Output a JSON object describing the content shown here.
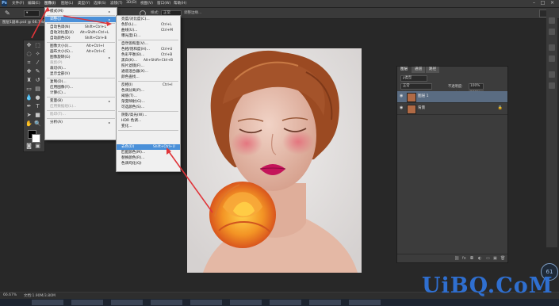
{
  "menubar": {
    "items": [
      "文件(F)",
      "编辑(E)",
      "图像(I)",
      "图层(L)",
      "类型(Y)",
      "选择(S)",
      "滤镜(T)",
      "3D(D)",
      "视图(V)",
      "窗口(W)",
      "帮助(H)"
    ]
  },
  "options_bar": {
    "field_label": "样式:",
    "field_value": "正常",
    "refine_label": "调整边缘..."
  },
  "tab_bar": {
    "doc_title": "图层1副本.psd @ 66.7%(RGB/8)"
  },
  "image_menu": {
    "items": [
      {
        "label": "模式(M)",
        "shortcut": "",
        "submenu": true
      },
      {
        "label": "调整(J)",
        "shortcut": "",
        "submenu": true,
        "highlight": true
      },
      {
        "label": "自动色调(N)",
        "shortcut": "Shift+Ctrl+L"
      },
      {
        "label": "自动对比度(U)",
        "shortcut": "Alt+Shift+Ctrl+L"
      },
      {
        "label": "自动颜色(O)",
        "shortcut": "Shift+Ctrl+B"
      },
      {
        "label": "图像大小(I)...",
        "shortcut": "Alt+Ctrl+I"
      },
      {
        "label": "画布大小(S)...",
        "shortcut": "Alt+Ctrl+C"
      },
      {
        "label": "图像旋转(G)",
        "shortcut": "",
        "submenu": true
      },
      {
        "label": "裁剪(P)",
        "shortcut": "",
        "disabled": true
      },
      {
        "label": "裁切(R)...",
        "shortcut": ""
      },
      {
        "label": "显示全部(V)",
        "shortcut": ""
      },
      {
        "label": "复制(D)...",
        "shortcut": ""
      },
      {
        "label": "应用图像(Y)...",
        "shortcut": ""
      },
      {
        "label": "计算(C)...",
        "shortcut": ""
      },
      {
        "label": "变量(B)",
        "shortcut": "",
        "submenu": true
      },
      {
        "label": "应用数据组(L)...",
        "shortcut": "",
        "disabled": true
      },
      {
        "label": "陷印(T)...",
        "shortcut": "",
        "disabled": true
      },
      {
        "label": "分析(A)",
        "shortcut": "",
        "submenu": true
      }
    ]
  },
  "adjust_menu": {
    "items": [
      {
        "label": "亮度/对比度(C)...",
        "shortcut": ""
      },
      {
        "label": "色阶(L)...",
        "shortcut": "Ctrl+L"
      },
      {
        "label": "曲线(U)...",
        "shortcut": "Ctrl+M"
      },
      {
        "label": "曝光度(E)...",
        "shortcut": ""
      },
      {
        "label": "自然饱和度(V)...",
        "shortcut": ""
      },
      {
        "label": "色相/饱和度(H)...",
        "shortcut": "Ctrl+U"
      },
      {
        "label": "色彩平衡(B)...",
        "shortcut": "Ctrl+B"
      },
      {
        "label": "黑白(K)...",
        "shortcut": "Alt+Shift+Ctrl+B"
      },
      {
        "label": "照片滤镜(F)...",
        "shortcut": ""
      },
      {
        "label": "通道混合器(X)...",
        "shortcut": ""
      },
      {
        "label": "颜色查找...",
        "shortcut": ""
      },
      {
        "label": "反相(I)",
        "shortcut": "Ctrl+I"
      },
      {
        "label": "色调分离(P)...",
        "shortcut": ""
      },
      {
        "label": "阈值(T)...",
        "shortcut": ""
      },
      {
        "label": "渐变映射(G)...",
        "shortcut": ""
      },
      {
        "label": "可选颜色(S)...",
        "shortcut": ""
      },
      {
        "label": "阴影/高光(W)...",
        "shortcut": ""
      },
      {
        "label": "HDR 色调...",
        "shortcut": ""
      },
      {
        "label": "变化...",
        "shortcut": ""
      },
      {
        "label": "去色(D)",
        "shortcut": "Shift+Ctrl+U",
        "highlight": true
      },
      {
        "label": "匹配颜色(M)...",
        "shortcut": ""
      },
      {
        "label": "替换颜色(R)...",
        "shortcut": ""
      },
      {
        "label": "色调均化(Q)",
        "shortcut": ""
      }
    ]
  },
  "layers_panel": {
    "tabs": [
      "图层",
      "通道",
      "路径"
    ],
    "filter_label": "ρ类型",
    "blend_mode": "正常",
    "opacity_label": "不透明度:",
    "opacity_value": "100%",
    "lock_label": "锁定:",
    "fill_label": "填充:",
    "fill_value": "100%",
    "layers": [
      {
        "name": "图层 1",
        "selected": true,
        "locked": false
      },
      {
        "name": "背景",
        "selected": false,
        "locked": true
      }
    ]
  },
  "status_bar": {
    "zoom": "66.67%",
    "doc_info": "文档:1.90M/3.80M"
  },
  "badge_text": "61",
  "watermark": "UiBQ.CoM",
  "colors": {
    "menu_highlight": "#4a90d9",
    "annotation_arrow": "#e0353a",
    "watermark": "#2f6fd0",
    "selected_layer": "#5a6c82"
  }
}
